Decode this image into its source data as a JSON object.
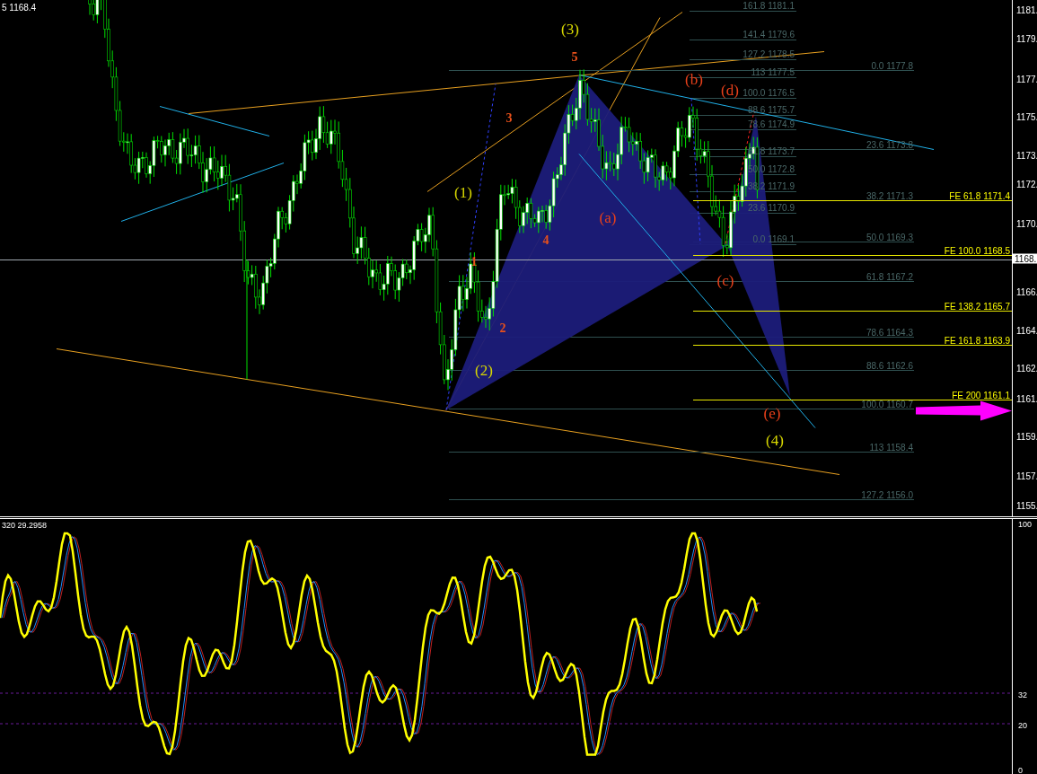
{
  "chart": {
    "header": "5 1168.4",
    "price_axis": {
      "labels": [
        "1181.",
        "1179.",
        "1177.",
        "1175.",
        "1173.",
        "1172.",
        "1170.",
        "1166.",
        "1164.",
        "1162.",
        "1161.",
        "1159.",
        "1157.",
        "1155."
      ],
      "current_price": "1168."
    },
    "fib_retracement_left": [
      "161.8 1181.1",
      "141.4 1179.6",
      "127.2 1178.5",
      "113 1177.5",
      "100.0 1176.5",
      "88.6 1175.7",
      "78.6 1174.9",
      "61.8 1173.7",
      "50.0 1172.8",
      "38.2 1171.9",
      "23.6 1170.9",
      "0.0 1169.1"
    ],
    "fib_retracement_right": [
      "0.0 1177.8",
      "23.6 1173.8",
      "38.2 1171.3",
      "50.0 1169.3",
      "61.8 1167.2",
      "78.6 1164.3",
      "88.6 1162.6",
      "100.0 1160.7",
      "113 1158.4",
      "127.2 1156.0"
    ],
    "fib_expansion": [
      "FE 61.8 1171.4",
      "FE 100.0 1168.5",
      "FE 138.2 1165.7",
      "FE 161.8 1163.9",
      "FE 200 1161.1"
    ],
    "wave_labels": [
      {
        "text": "(3)",
        "color": "#d8d800"
      },
      {
        "text": "5",
        "color": "#e8501a"
      },
      {
        "text": "3",
        "color": "#e8501a"
      },
      {
        "text": "(1)",
        "color": "#d8d800"
      },
      {
        "text": "1",
        "color": "#e8501a"
      },
      {
        "text": "4",
        "color": "#e8501a"
      },
      {
        "text": "2",
        "color": "#e8501a"
      },
      {
        "text": "(2)",
        "color": "#d8d800"
      },
      {
        "text": "(a)",
        "color": "#e8401a"
      },
      {
        "text": "(b)",
        "color": "#e8401a"
      },
      {
        "text": "(d)",
        "color": "#e8401a"
      },
      {
        "text": "(c)",
        "color": "#e8401a"
      },
      {
        "text": "(e)",
        "color": "#e8401a"
      },
      {
        "text": "(4)",
        "color": "#d8d800"
      }
    ]
  },
  "indicator": {
    "readout": "320 29.2958",
    "axis_labels": [
      "100",
      "32",
      "20",
      "0"
    ]
  }
}
